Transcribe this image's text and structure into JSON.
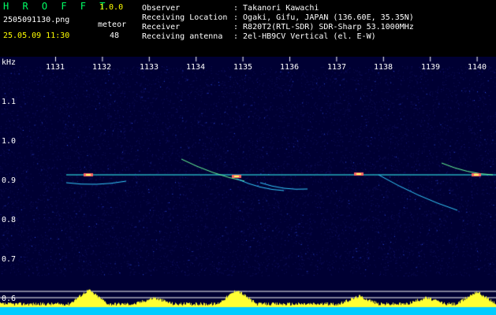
{
  "header": {
    "app_name": "H R O F F T",
    "version": "1.0.0",
    "filename": "2505091130.png",
    "datetime": "25.05.09 11:30",
    "meteor_label": "meteor",
    "meteor_count": "48",
    "fields": [
      {
        "label": "Observer",
        "value": ": Takanori Kawachi"
      },
      {
        "label": "Receiving Location",
        "value": ": Ogaki, Gifu, JAPAN (136.60E, 35.35N)"
      },
      {
        "label": "Receiver",
        "value": ": R820T2(RTL-SDR) SDR-Sharp 53.1000MHz"
      },
      {
        "label": "Receiving antenna",
        "value": ": 2el-HB9CV Vertical (el. E-W)"
      }
    ]
  },
  "spectrogram": {
    "unit_label": "kHz",
    "x_ticks": [
      "1131",
      "1132",
      "1133",
      "1134",
      "1135",
      "1136",
      "1137",
      "1138",
      "1139",
      "1140"
    ],
    "y_ticks": [
      "1.1",
      "1.0",
      "0.9",
      "0.8",
      "0.7",
      "0.6"
    ],
    "colors": {
      "background": "#000033",
      "trace": "#33ffff",
      "echo": "#ffff33",
      "baseline": "#00ccff"
    }
  }
}
